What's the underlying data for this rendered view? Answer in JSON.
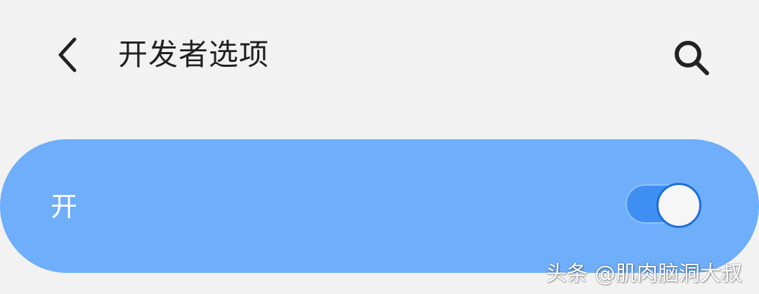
{
  "header": {
    "back_icon": "chevron-left-icon",
    "title": "开发者选项",
    "search_icon": "search-icon"
  },
  "master_switch": {
    "label": "开",
    "state": "on"
  },
  "watermark": {
    "text": "头条 @肌肉脑洞大叔"
  },
  "colors": {
    "background": "#f2f2f2",
    "card": "#6eaefb",
    "toggle_track": "#3f8ff2",
    "toggle_knob": "#f6f6f6",
    "title_text": "#222222"
  }
}
